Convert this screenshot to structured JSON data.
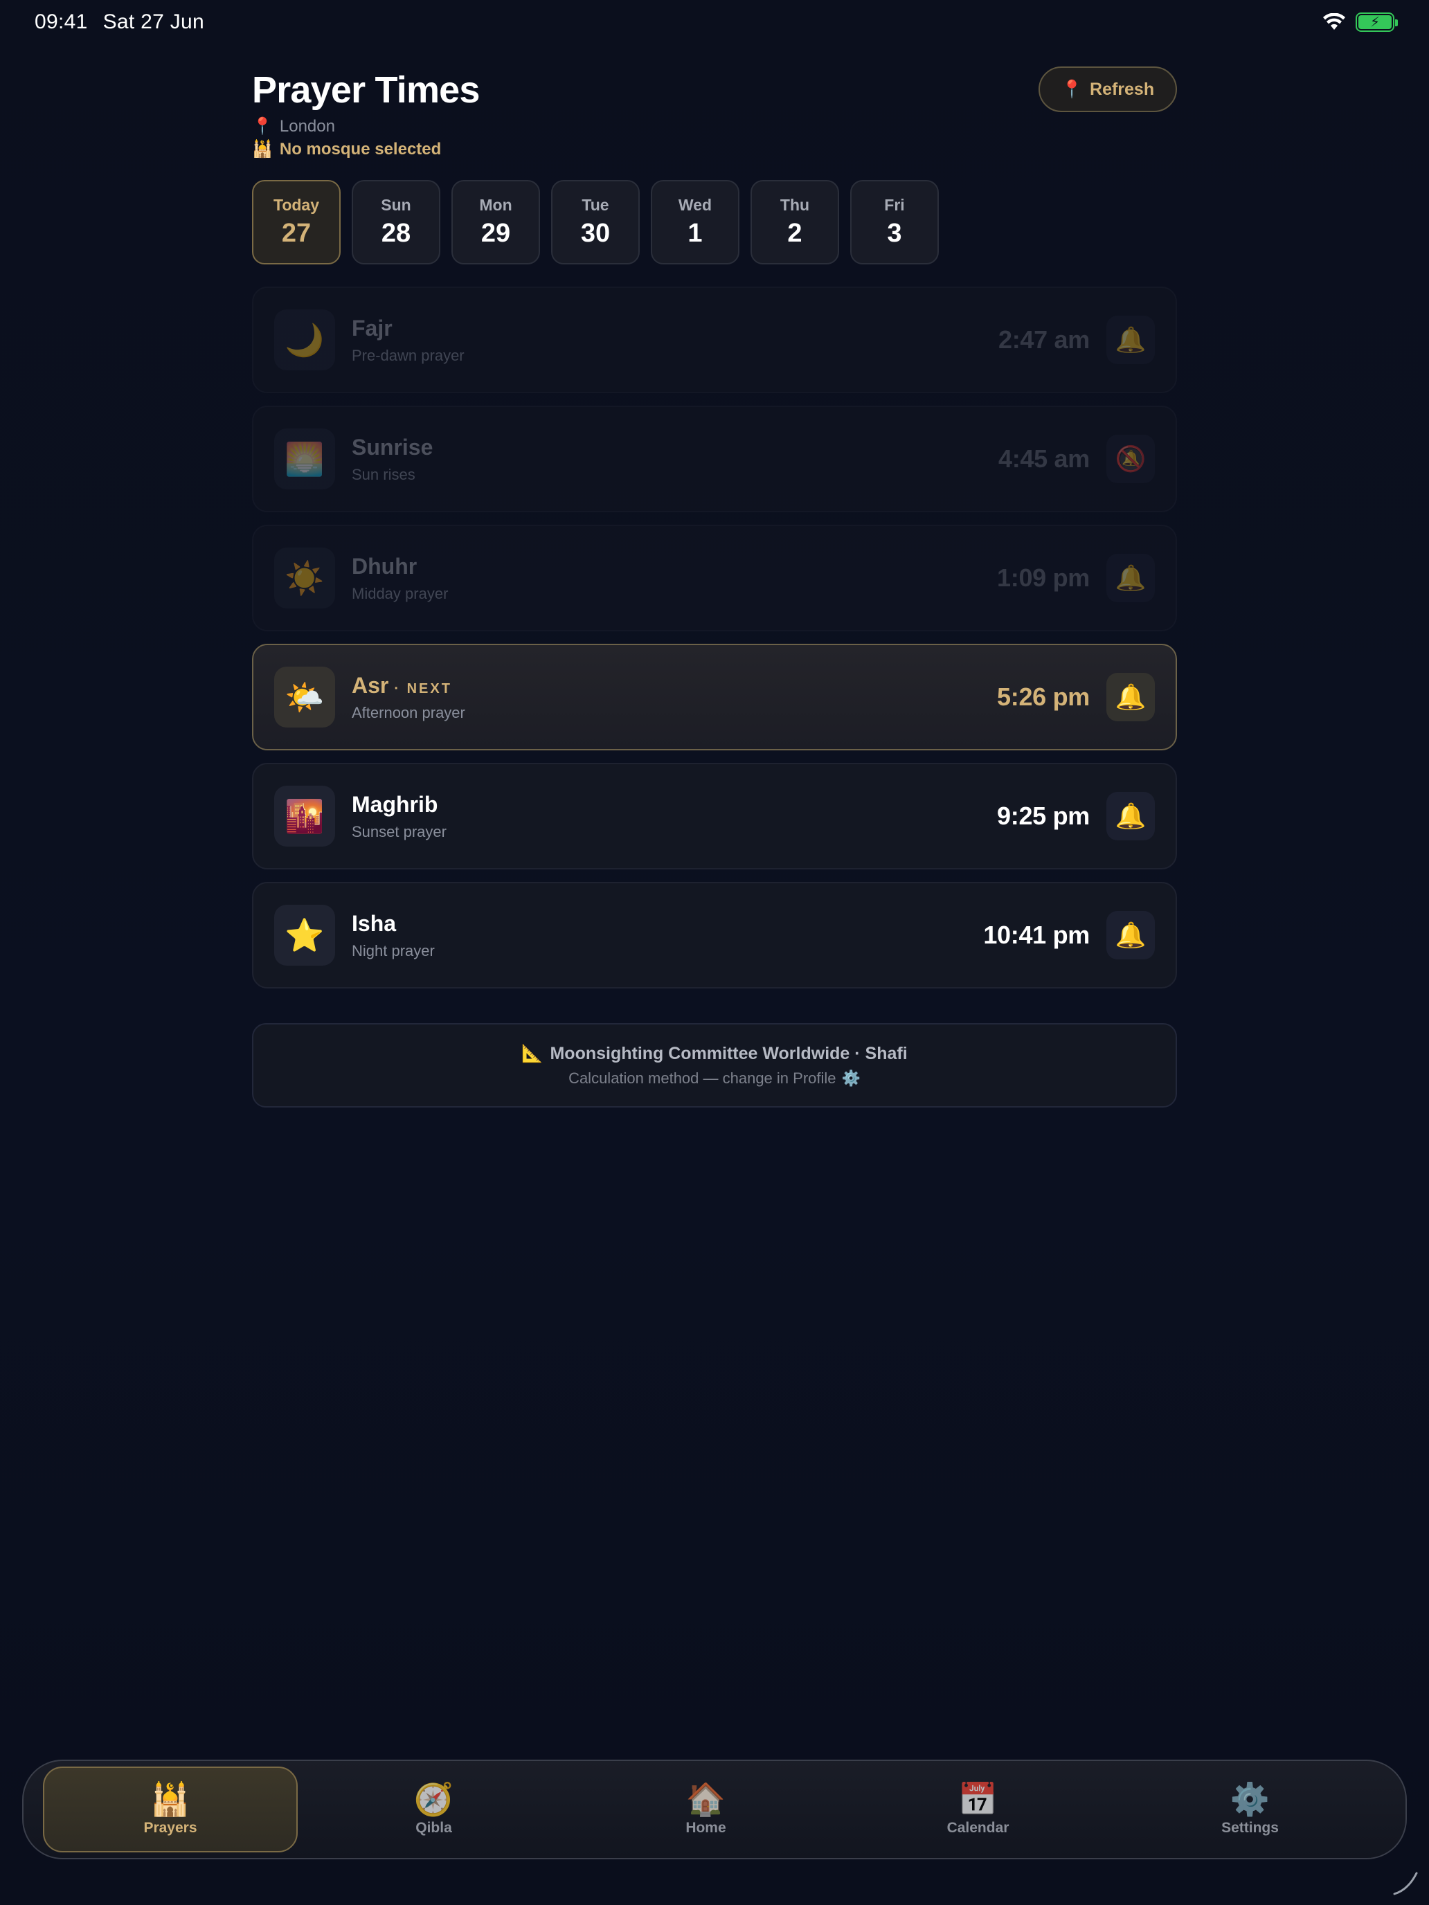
{
  "status_bar": {
    "time": "09:41",
    "date": "Sat 27 Jun"
  },
  "header": {
    "title": "Prayer Times",
    "location_icon": "📍",
    "location": "London",
    "mosque_icon": "🕌",
    "mosque": "No mosque selected",
    "refresh_icon": "📍",
    "refresh_label": "Refresh"
  },
  "days": [
    {
      "name": "Today",
      "num": "27",
      "active": true
    },
    {
      "name": "Sun",
      "num": "28"
    },
    {
      "name": "Mon",
      "num": "29"
    },
    {
      "name": "Tue",
      "num": "30"
    },
    {
      "name": "Wed",
      "num": "1"
    },
    {
      "name": "Thu",
      "num": "2"
    },
    {
      "name": "Fri",
      "num": "3"
    }
  ],
  "prayers": [
    {
      "icon": "🌙",
      "name": "Fajr",
      "sub": "Pre-dawn prayer",
      "time": "2:47 am",
      "bell": "🔔",
      "state": "past"
    },
    {
      "icon": "🌅",
      "name": "Sunrise",
      "sub": "Sun rises",
      "time": "4:45 am",
      "bell": "🔕",
      "state": "past"
    },
    {
      "icon": "☀️",
      "name": "Dhuhr",
      "sub": "Midday prayer",
      "time": "1:09 pm",
      "bell": "🔔",
      "state": "past"
    },
    {
      "icon": "🌤️",
      "name": "Asr",
      "tag": "· NEXT",
      "sub": "Afternoon prayer",
      "time": "5:26 pm",
      "bell": "🔔",
      "state": "next"
    },
    {
      "icon": "🌇",
      "name": "Maghrib",
      "sub": "Sunset prayer",
      "time": "9:25 pm",
      "bell": "🔔",
      "state": "upcoming"
    },
    {
      "icon": "⭐",
      "name": "Isha",
      "sub": "Night prayer",
      "time": "10:41 pm",
      "bell": "🔔",
      "state": "upcoming"
    }
  ],
  "method": {
    "icon": "📐",
    "title": "Moonsighting Committee Worldwide · Shafi",
    "sub": "Calculation method — change in Profile",
    "sub_icon": "⚙️"
  },
  "tabs": [
    {
      "icon": "🕌",
      "label": "Prayers",
      "active": true
    },
    {
      "icon": "🧭",
      "label": "Qibla"
    },
    {
      "icon": "🏠",
      "label": "Home"
    },
    {
      "icon": "📅",
      "label": "Calendar"
    },
    {
      "icon": "⚙️",
      "label": "Settings"
    }
  ],
  "colors": {
    "accent": "#d4b378",
    "background": "#0b0f1d",
    "card": "#131722",
    "battery": "#34c759"
  }
}
